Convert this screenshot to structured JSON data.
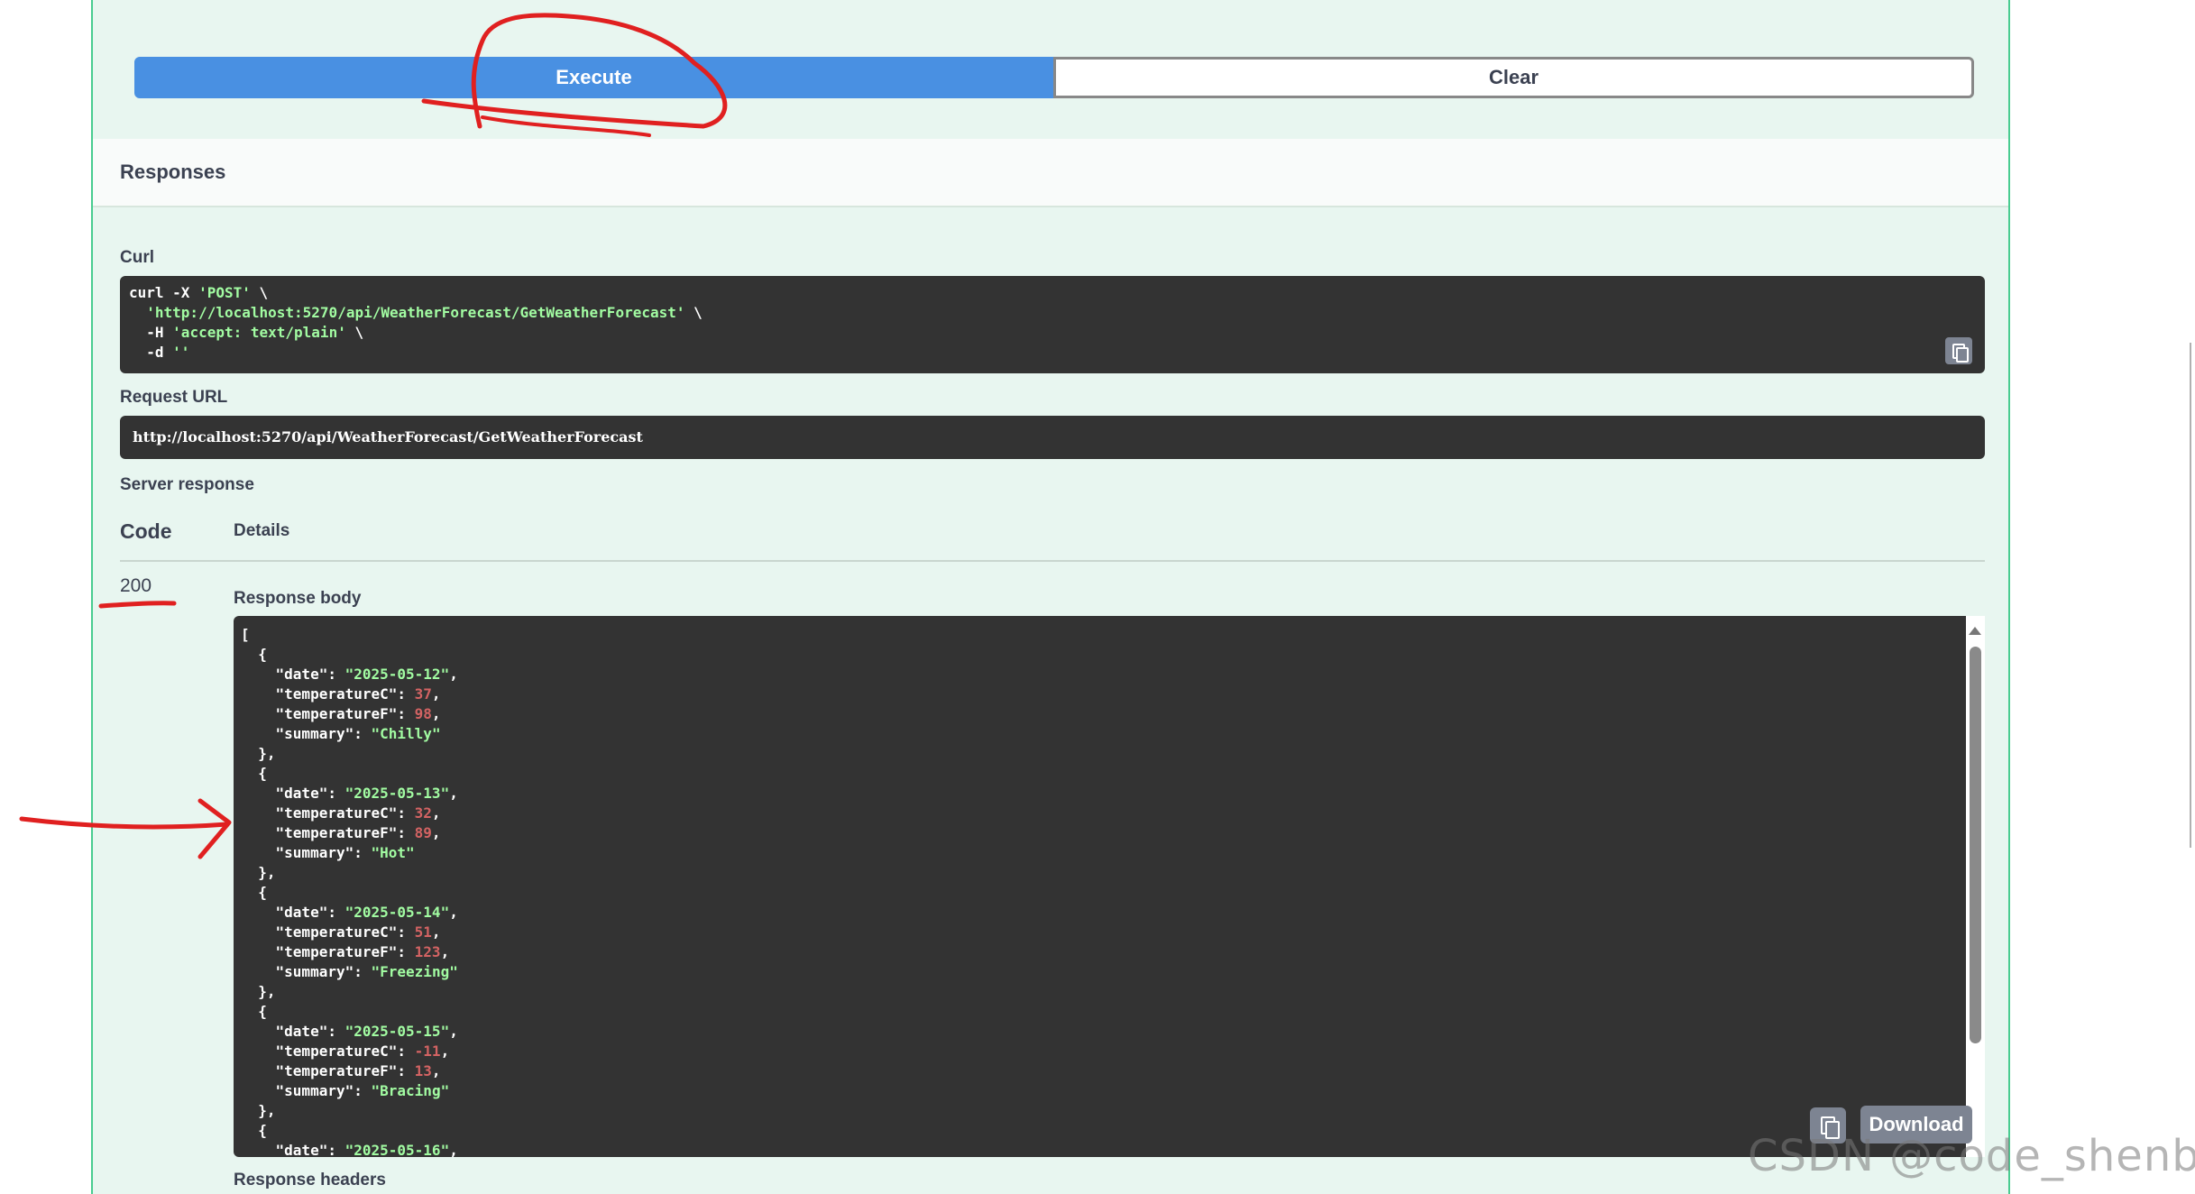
{
  "actions": {
    "execute_label": "Execute",
    "clear_label": "Clear"
  },
  "responses": {
    "title": "Responses"
  },
  "curl": {
    "label": "Curl",
    "lines": [
      {
        "pre": "curl -X ",
        "str": "'POST'",
        "post": " \\"
      },
      {
        "pre": "  ",
        "str": "'http://localhost:5270/api/WeatherForecast/GetWeatherForecast'",
        "post": " \\"
      },
      {
        "pre": "  -H ",
        "str": "'accept: text/plain'",
        "post": " \\"
      },
      {
        "pre": "  -d ",
        "str": "''",
        "post": ""
      }
    ]
  },
  "request_url": {
    "label": "Request URL",
    "value": "http://localhost:5270/api/WeatherForecast/GetWeatherForecast"
  },
  "server_response": {
    "label": "Server response",
    "code_header": "Code",
    "details_header": "Details",
    "status_code": "200",
    "body_label": "Response body",
    "headers_label": "Response headers",
    "download_label": "Download",
    "items": [
      {
        "date": "2025-05-12",
        "temperatureC": "37",
        "temperatureF": "98",
        "summary": "Chilly"
      },
      {
        "date": "2025-05-13",
        "temperatureC": "32",
        "temperatureF": "89",
        "summary": "Hot"
      },
      {
        "date": "2025-05-14",
        "temperatureC": "51",
        "temperatureF": "123",
        "summary": "Freezing"
      },
      {
        "date": "2025-05-15",
        "temperatureC": "-11",
        "temperatureF": "13",
        "summary": "Bracing"
      },
      {
        "date": "2025-05-16"
      }
    ]
  },
  "watermark": "CSDN @code_shenbing",
  "colors": {
    "execute": "#4990e2",
    "block_border": "#49cc90",
    "code_bg": "#333333",
    "string": "#a2fca2",
    "number": "#d36363",
    "annotation": "#e02020"
  }
}
